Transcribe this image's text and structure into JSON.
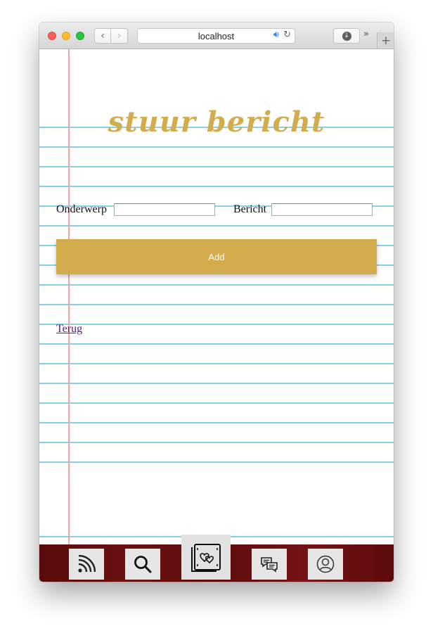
{
  "browser": {
    "url": "localhost",
    "back_glyph": "‹",
    "forward_glyph": "›",
    "more_glyph": "»",
    "newtab_glyph": "+",
    "download_glyph": "↓"
  },
  "page": {
    "title": "stuur bericht",
    "form": {
      "subject_label": "Onderwerp",
      "subject_value": "",
      "message_label": "Bericht",
      "message_value": "",
      "add_label": "Add"
    },
    "back_link": "Terug"
  },
  "bottom_nav": {
    "icons": [
      "rss-feed-icon",
      "search-icon",
      "matches-hearts-icon",
      "chat-bubbles-icon",
      "profile-icon"
    ],
    "active": "matches-hearts-icon"
  },
  "colors": {
    "accent": "#d3ac4e",
    "nav_background": "#5d0c0d",
    "rule_lines": "#8bd0ea",
    "margin_line": "#f2a7a7",
    "link": "#551a8b"
  }
}
